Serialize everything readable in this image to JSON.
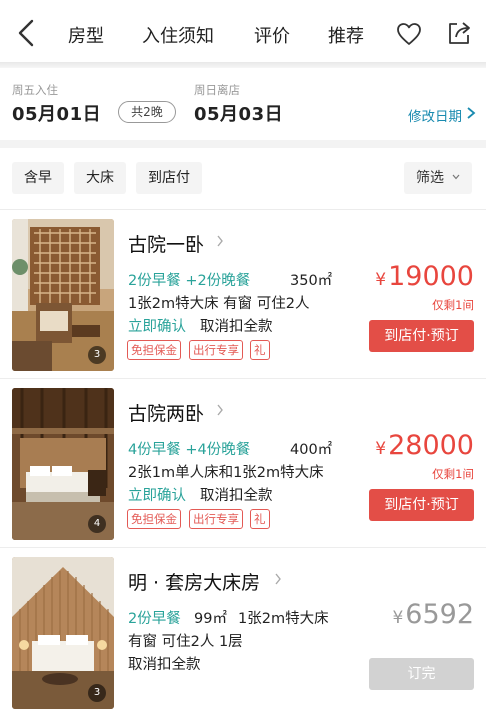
{
  "nav": {
    "back_icon": "chevron-left-icon",
    "tabs": [
      "房型",
      "入住须知",
      "评价",
      "推荐"
    ],
    "favorite_icon": "heart-icon",
    "share_icon": "share-icon"
  },
  "stay": {
    "checkin_label": "周五入住",
    "checkin_date": "05月01日",
    "nights": "共2晚",
    "checkout_label": "周日离店",
    "checkout_date": "05月03日",
    "modify_label": "修改日期"
  },
  "filters": {
    "chips": [
      "含早",
      "大床",
      "到店付"
    ],
    "select_label": "筛选"
  },
  "rooms": [
    {
      "name": "古院一卧",
      "meals": "2份早餐 +2份晚餐",
      "area": "350㎡",
      "beds": "1张2m特大床  有窗  可住2人",
      "confirm": "立即确认",
      "cancel": "取消扣全款",
      "tags": [
        "免担保金",
        "出行专享",
        "礼"
      ],
      "currency": "¥",
      "price": "19000",
      "remaining": "仅剩1间",
      "button": "到店付·预订",
      "photo_count": "3"
    },
    {
      "name": "古院两卧",
      "meals": "4份早餐 +4份晚餐",
      "area": "400㎡",
      "beds": "2张1m单人床和1张2m特大床",
      "confirm": "立即确认",
      "cancel": "取消扣全款",
      "tags": [
        "免担保金",
        "出行专享",
        "礼"
      ],
      "currency": "¥",
      "price": "28000",
      "remaining": "仅剩1间",
      "button": "到店付·预订",
      "photo_count": "4"
    },
    {
      "name": "明 · 套房大床房",
      "meals": "2份早餐",
      "area": "99㎡",
      "beds_line1": "1张2m特大床",
      "beds_line2": "有窗  可住2人  1层",
      "cancel": "取消扣全款",
      "currency": "¥",
      "price": "6592",
      "button": "订完",
      "photo_count": "3"
    }
  ],
  "colors": {
    "accent_red": "#e8463e",
    "teal": "#2aa39a",
    "link_blue": "#1a8bb0",
    "sold_out_grey": "#d2d2d2"
  }
}
